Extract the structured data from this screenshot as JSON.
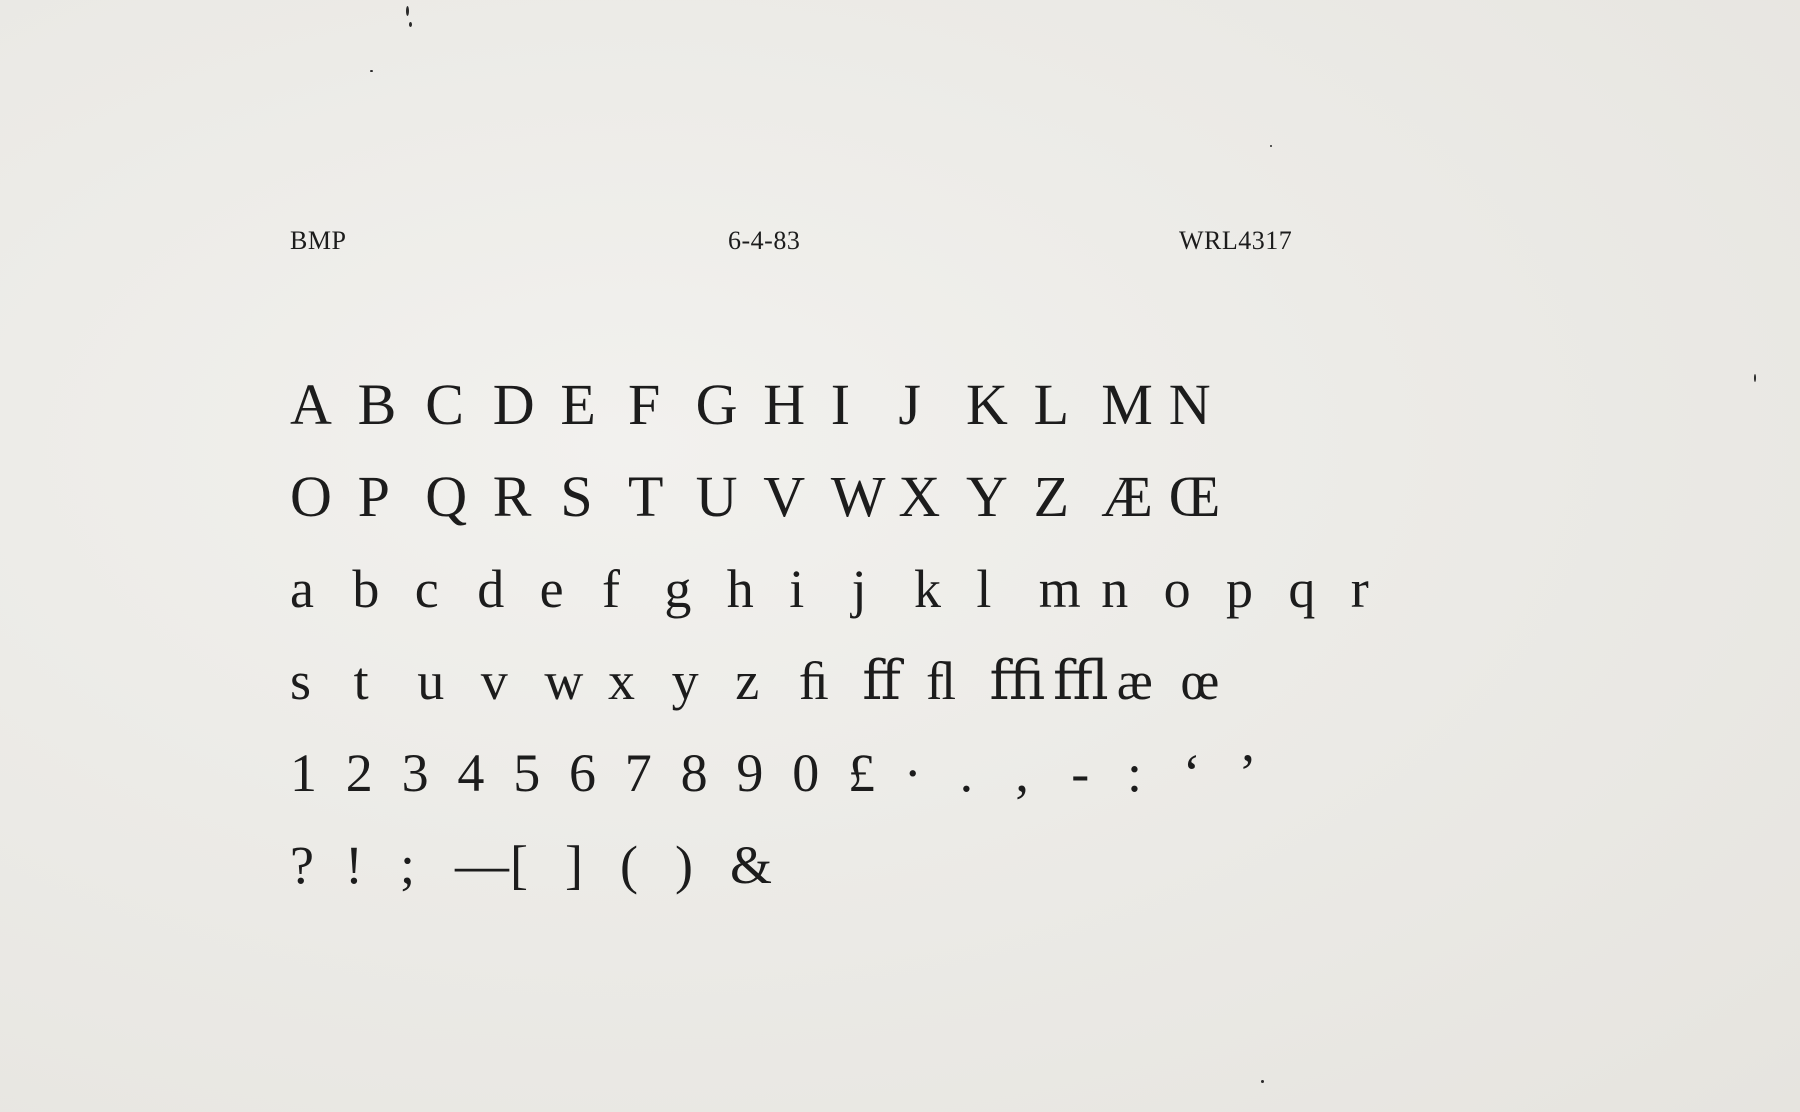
{
  "header": {
    "left": "BMP",
    "center": "6-4-83",
    "right": "WRL4317"
  },
  "rows": [
    [
      "A",
      "B",
      "C",
      "D",
      "E",
      "F",
      "G",
      "H",
      "I",
      "J",
      "K",
      "L",
      "M",
      "N"
    ],
    [
      "O",
      "P",
      "Q",
      "R",
      "S",
      "T",
      "U",
      "V",
      "W",
      "X",
      "Y",
      "Z",
      "Æ",
      "Œ"
    ],
    [
      "a",
      "b",
      "c",
      "d",
      "e",
      "f",
      "g",
      "h",
      "i",
      "j",
      "k",
      "l",
      "m",
      "n",
      "o",
      "p",
      "q",
      "r"
    ],
    [
      "s",
      "t",
      "u",
      "v",
      "w",
      "x",
      "y",
      "z",
      "ﬁ",
      "ﬀ",
      "ﬂ",
      "ﬃ",
      "ﬄ",
      "æ",
      "œ"
    ],
    [
      "1",
      "2",
      "3",
      "4",
      "5",
      "6",
      "7",
      "8",
      "9",
      "0",
      "£",
      "·",
      ".",
      ",",
      "-",
      ":",
      "‘",
      "’"
    ],
    [
      "?",
      "!",
      ";",
      "—",
      "[",
      "]",
      "(",
      ")",
      "&"
    ]
  ],
  "colors": {
    "paper": "#ecebe7",
    "ink": "#1c1c1c"
  }
}
